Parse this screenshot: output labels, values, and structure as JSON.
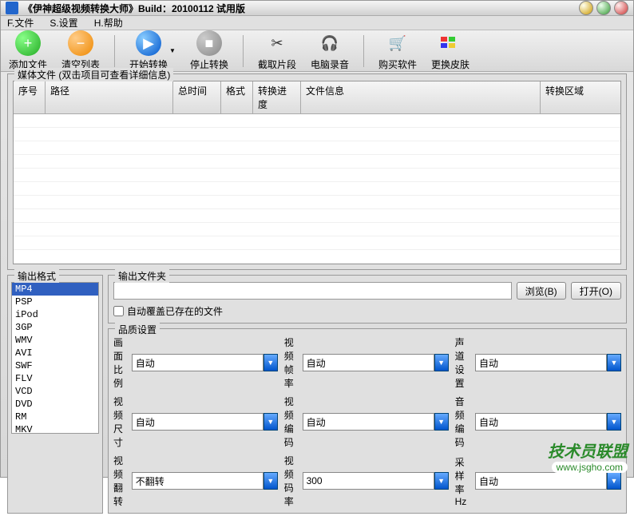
{
  "title": "《伊神超级视频转换大师》Build：20100112 试用版",
  "menu": {
    "file": "F.文件",
    "settings": "S.设置",
    "help": "H.帮助"
  },
  "toolbar": {
    "add": "添加文件",
    "clear": "清空列表",
    "start": "开始转换",
    "stop": "停止转换",
    "cut": "截取片段",
    "record": "电脑录音",
    "buy": "购买软件",
    "skin": "更换皮肤"
  },
  "media_group": "媒体文件 (双击项目可查看详细信息)",
  "columns": {
    "seq": "序号",
    "path": "路径",
    "duration": "总时间",
    "format": "格式",
    "progress": "转换进度",
    "info": "文件信息",
    "region": "转换区域"
  },
  "output_format_label": "输出格式",
  "formats": [
    "MP4",
    "PSP",
    "iPod",
    "3GP",
    "WMV",
    "AVI",
    "SWF",
    "FLV",
    "VCD",
    "DVD",
    "RM",
    "MKV"
  ],
  "output_folder": {
    "label": "输出文件夹",
    "value": "",
    "browse": "浏览(B)",
    "open": "打开(O)",
    "overwrite": "自动覆盖已存在的文件"
  },
  "quality": {
    "label": "品质设置",
    "aspect": "画面比例",
    "aspect_v": "自动",
    "fps": "视频帧率",
    "fps_v": "自动",
    "channel": "声道设置",
    "channel_v": "自动",
    "size": "视频尺寸",
    "size_v": "自动",
    "vcodec": "视频编码",
    "vcodec_v": "自动",
    "acodec": "音频编码",
    "acodec_v": "自动",
    "flip": "视频翻转",
    "flip_v": "不翻转",
    "bitrate": "视频码率",
    "bitrate_v": "300",
    "sample": "采样率Hz",
    "sample_v": "自动"
  },
  "watermark": {
    "line1": "技术员联盟",
    "line2": "www.jsgho.com"
  }
}
